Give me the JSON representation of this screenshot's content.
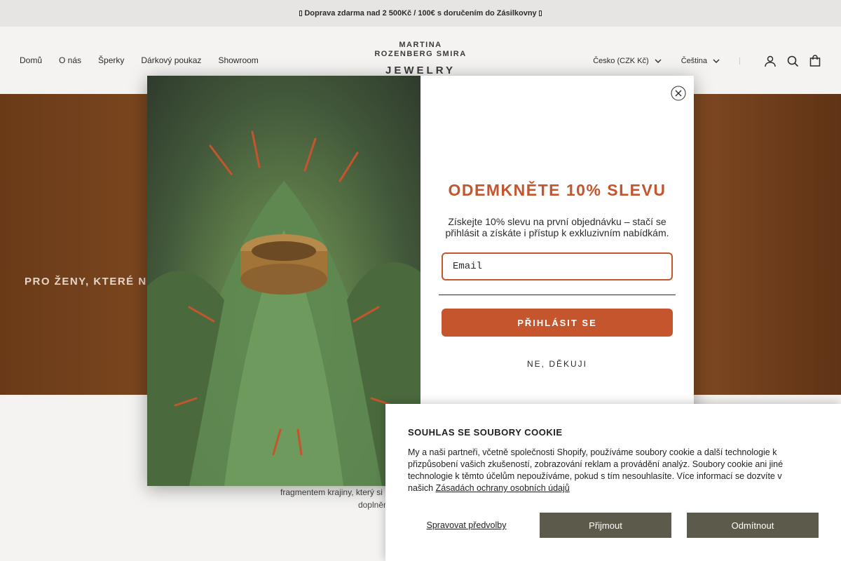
{
  "announcement": {
    "text": "Doprava zdarma nad 2 500Kč / 100€ s doručením do Zásilkovny"
  },
  "header": {
    "nav": [
      "Domů",
      "O nás",
      "Šperky",
      "Dárkový poukaz",
      "Showroom"
    ],
    "logo_line1": "MARTINA",
    "logo_line2": "ROZENBERG SMIRA",
    "logo_line3": "JEWELRY",
    "currency": "Česko (CZK Kč)",
    "language": "Čeština"
  },
  "hero": {
    "text": "PRO ŽENY, KTERÉ NE"
  },
  "lower": {
    "line1": "fragmentem krajiny, který si můžete vzít s sebou kamkoli",
    "line2": "doplněné sladí"
  },
  "popup": {
    "title": "ODEMKNĚTE 10% SLEVU",
    "text": "Získejte 10% slevu na první objednávku – stačí se přihlásit a získáte i přístup k exkluzivním nabídkám.",
    "email_placeholder": "Email",
    "submit_label": "PŘIHLÁSIT SE",
    "decline_label": "NE, DĚKUJI"
  },
  "cookie": {
    "title": "SOUHLAS SE SOUBORY COOKIE",
    "text": "My a naši partneři, včetně společnosti Shopify, používáme soubory cookie a další technologie k přizpůsobení vašich zkušeností, zobrazování reklam a provádění analýz. Soubory cookie ani jiné technologie k těmto účelům nepoužíváme, pokud s tím nesouhlasíte. Více informací se dozvíte v našich",
    "link": "Zásadách ochrany osobních údajů",
    "manage_label": "Spravovat předvolby",
    "accept_label": "Přijmout",
    "reject_label": "Odmítnout"
  }
}
